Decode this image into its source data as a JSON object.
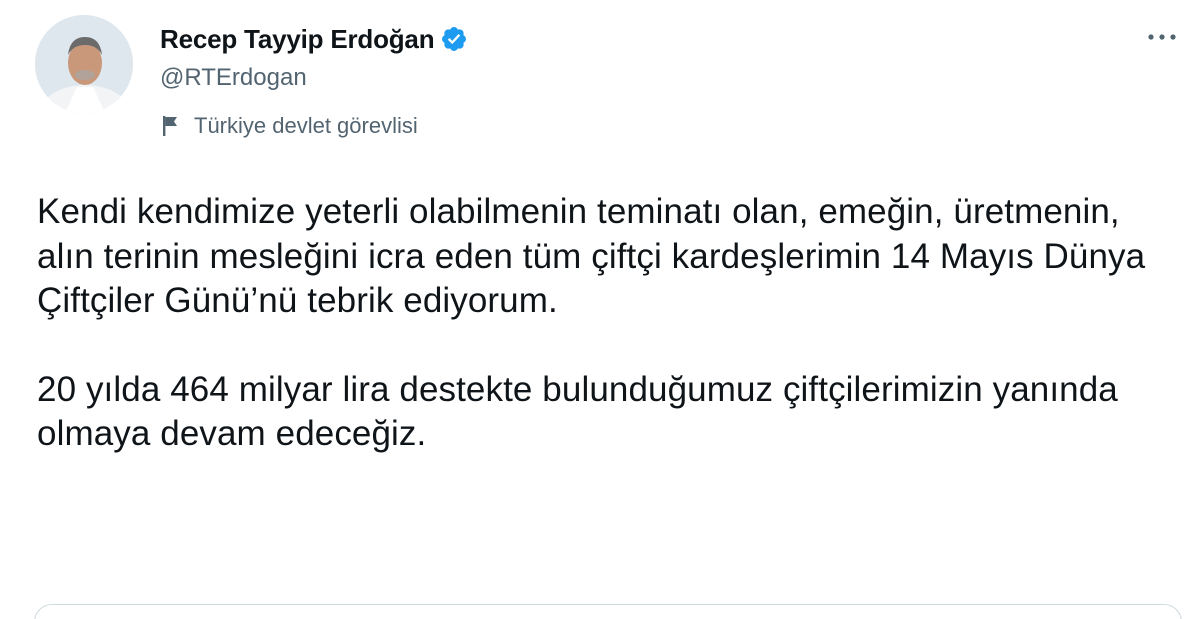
{
  "author": {
    "display_name": "Recep Tayyip Erdoğan",
    "handle": "@RTErdogan",
    "verified": true,
    "account_label": "Türkiye devlet görevlisi"
  },
  "tweet": {
    "paragraphs": [
      "Kendi kendimize yeterli olabilmenin teminatı olan, emeğin, üretmenin, alın terinin mesleğini icra eden tüm çiftçi kardeşlerimin 14 Mayıs Dünya Çiftçiler Günü’nü tebrik ediyorum.",
      "20 yılda 464 milyar lira destekte bulunduğumuz çiftçilerimizin yanında olmaya devam edeceğiz."
    ]
  },
  "icons": {
    "verified": "verified-badge-icon",
    "label": "flag-icon",
    "more": "more-icon"
  },
  "colors": {
    "text": "#0f1419",
    "secondary": "#536471",
    "verified_blue": "#1d9bf0",
    "border": "#cfd9de"
  }
}
